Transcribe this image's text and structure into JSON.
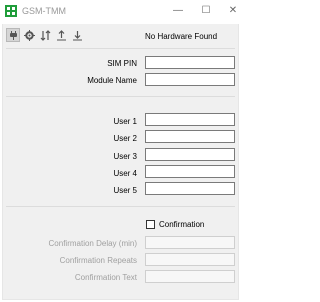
{
  "window": {
    "title": "GSM-TMM",
    "minimize_glyph": "—",
    "maximize_glyph": "☐",
    "close_glyph": "✕",
    "app_icon": "green-grid-icon"
  },
  "toolbar": {
    "buttons": [
      {
        "icon": "plug-icon",
        "active": true
      },
      {
        "icon": "gear-icon",
        "active": false
      },
      {
        "icon": "sort-arrows-icon",
        "active": false
      },
      {
        "icon": "upload-icon",
        "active": false
      },
      {
        "icon": "download-icon",
        "active": false
      }
    ],
    "hardware_status": "No Hardware Found"
  },
  "sim": {
    "pin_label": "SIM PIN",
    "pin_value": "",
    "module_label": "Module Name",
    "module_value": ""
  },
  "users": [
    {
      "label": "User 1",
      "value": ""
    },
    {
      "label": "User 2",
      "value": ""
    },
    {
      "label": "User 3",
      "value": ""
    },
    {
      "label": "User 4",
      "value": ""
    },
    {
      "label": "User 5",
      "value": ""
    }
  ],
  "confirmation": {
    "checkbox_label": "Confirmation",
    "checked": false,
    "delay_label": "Confirmation Delay (min)",
    "delay_value": "",
    "repeats_label": "Confirmation Repeats",
    "repeats_value": "",
    "text_label": "Confirmation Text",
    "text_value": ""
  },
  "colors": {
    "app_icon_green": "#1f9d3a",
    "disabled_text": "#a0a0a0",
    "client_bg": "#f0f0f0"
  }
}
